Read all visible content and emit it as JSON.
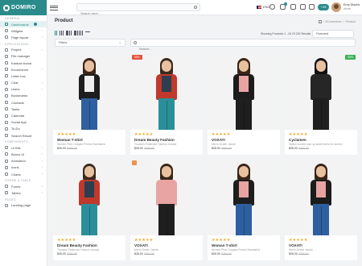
{
  "brand": {
    "name": "DOMIRO"
  },
  "sidebar": {
    "sections": [
      {
        "title": "GENERAL",
        "items": [
          {
            "label": "Dashboards",
            "icon": "home-icon",
            "active": true,
            "badge": true
          },
          {
            "label": "Widgets",
            "icon": "widget-icon",
            "arrow": true
          },
          {
            "label": "Page layout",
            "icon": "layout-icon",
            "arrow": true
          }
        ]
      },
      {
        "title": "APPLICATIONS",
        "items": [
          {
            "label": "Project",
            "icon": "project-icon",
            "arrow": true
          },
          {
            "label": "File manager",
            "icon": "folder-icon"
          },
          {
            "label": "Kanban board",
            "icon": "kanban-icon"
          },
          {
            "label": "Ecommerce",
            "icon": "cart-icon",
            "arrow": true
          },
          {
            "label": "Letter box",
            "icon": "mail-icon"
          },
          {
            "label": "Chat",
            "icon": "chat-icon",
            "arrow": true
          },
          {
            "label": "Users",
            "icon": "users-icon",
            "arrow": true
          },
          {
            "label": "Bookmarks",
            "icon": "bookmark-icon"
          },
          {
            "label": "Contacts",
            "icon": "contacts-icon"
          },
          {
            "label": "Tasks",
            "icon": "tasks-icon"
          },
          {
            "label": "Calendar",
            "icon": "calendar-icon"
          },
          {
            "label": "Social App",
            "icon": "social-icon"
          },
          {
            "label": "To-Do",
            "icon": "todo-icon"
          },
          {
            "label": "Search Result",
            "icon": "search-icon"
          }
        ]
      },
      {
        "title": "COMPONENTS",
        "items": [
          {
            "label": "Ui Kits",
            "icon": "kit-icon",
            "arrow": true
          },
          {
            "label": "Bonus Ui",
            "icon": "bonus-icon",
            "arrow": true
          },
          {
            "label": "Animation",
            "icon": "animation-icon",
            "arrow": true
          },
          {
            "label": "Icons",
            "icon": "icons-icon",
            "arrow": true
          },
          {
            "label": "Charts",
            "icon": "chart-icon",
            "arrow": true
          }
        ]
      },
      {
        "title": "FORMS & TABLE",
        "items": [
          {
            "label": "Forms",
            "icon": "form-icon",
            "arrow": true
          },
          {
            "label": "Tables",
            "icon": "table-icon",
            "arrow": true
          }
        ]
      },
      {
        "title": "PAGES",
        "items": [
          {
            "label": "Landing page",
            "icon": "landing-icon"
          }
        ]
      }
    ]
  },
  "header": {
    "search_placeholder": "Search here...",
    "language": "ENG",
    "pill": "+ 89",
    "user_name": "Emy Dlacris",
    "user_role": "Admin"
  },
  "page": {
    "title": "Product",
    "breadcrumb": [
      "/",
      "ECommerce",
      "/",
      "Product"
    ],
    "showing": "Showing Products 1 - 24 Of 200 Results",
    "sort": "Featured",
    "filter_label": "Filters",
    "search_placeholder": "Search..."
  },
  "products": [
    {
      "name": "Woman T-shirt",
      "desc": "Women Pink Cropped Printed Sweatshirt",
      "price": "$26.00",
      "old": "$350.00",
      "tag": "",
      "hair": "#3b2418",
      "torso": "#1e1e1e",
      "inner": "#efefef",
      "legs": "#2e5fa0"
    },
    {
      "name": "Dream Beauty Fashion",
      "desc": "Trousers Patterned Fashion Jumper",
      "price": "$26.00",
      "old": "$350.00",
      "tag": "50%",
      "tag_style": "",
      "hair": "#3a2a1e",
      "torso": "#c0392b",
      "inner": "#2c3e50",
      "legs": "#2a8f9a"
    },
    {
      "name": "VOXATI",
      "desc": "Men's Denim Jacket",
      "price": "$26.00",
      "old": "$350.00",
      "tag": "",
      "hair": "#3b2418",
      "torso": "#1c1c1c",
      "inner": "#e8a3a3",
      "legs": "#1f1f1f"
    },
    {
      "name": "Cyclamen",
      "desc": "Stylish women lace up ankle heels for women",
      "price": "$26.00",
      "old": "$350.00",
      "tag": "50%",
      "tag_style": "right",
      "hair": "#111111",
      "torso": "#262626",
      "inner": "#262626",
      "legs": "#1f1f1f"
    },
    {
      "name": "Dream Beauty Fashion",
      "desc": "Trousers Patterned Fashion Jumper",
      "price": "$26.00",
      "old": "$350.00",
      "tag": "",
      "hair": "#3a2a1e",
      "torso": "#c0392b",
      "inner": "#2c3e50",
      "legs": "#2a8f9a"
    },
    {
      "name": "VOXATI",
      "desc": "Men's Denim Jacket",
      "price": "$26.00",
      "old": "$350.00",
      "tag": "",
      "tag_style": "orange",
      "hair": "#3b2418",
      "torso": "#e8a3a3",
      "inner": "#e8a3a3",
      "legs": "#1f1f1f"
    },
    {
      "name": "Woman T-shirt",
      "desc": "Women Pink Cropped Printed Sweatshirt",
      "price": "$26.00",
      "old": "$350.00",
      "tag": "",
      "hair": "#3b2418",
      "torso": "#1e1e1e",
      "inner": "#e8a3a3",
      "legs": "#2e5fa0"
    },
    {
      "name": "VOXATI",
      "desc": "Men's Denim Jacket",
      "price": "$26.00",
      "old": "$350.00",
      "tag": "",
      "hair": "#3b2418",
      "torso": "#1c1c1c",
      "inner": "#e8a3a3",
      "legs": "#2e5fa0"
    }
  ],
  "stars": "★★★★★",
  "colors": {
    "accent": "#2b8b8b",
    "star": "#f5a623",
    "sale": "#e5533d",
    "new": "#3cb35a"
  }
}
